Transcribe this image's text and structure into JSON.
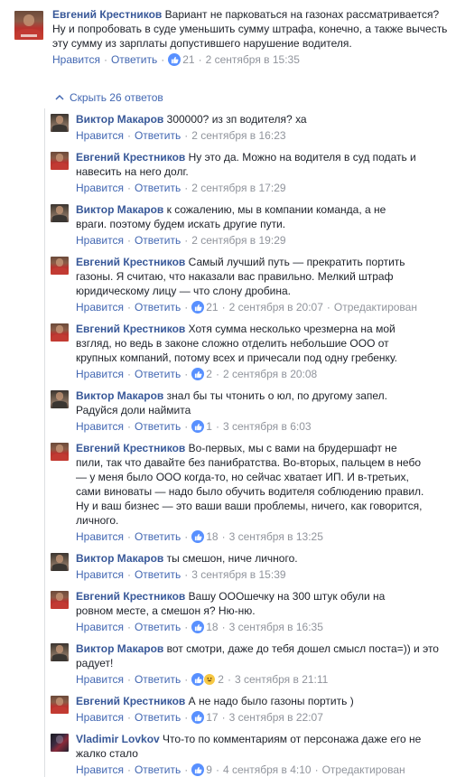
{
  "top_comment": {
    "author": "Евгений Крестников",
    "text": "Вариант не парковаться на газонах рассматривается? Ну и попробовать в суде уменьшить сумму штрафа, конечно, а также вычесть эту сумму из зарплаты допустившего нарушение водителя.",
    "like_label": "Нравится",
    "reply_label": "Ответить",
    "reactions": "21",
    "timestamp": "2 сентября в 15:35"
  },
  "hide_replies_label": "Скрыть 26 ответов",
  "replies": [
    {
      "author": "Виктор Макаров",
      "text": "300000? из зп водителя? ха",
      "like_label": "Нравится",
      "reply_label": "Ответить",
      "reactions": "",
      "timestamp": "2 сентября в 16:23",
      "edited": ""
    },
    {
      "author": "Евгений Крестников",
      "text": "Ну это да. Можно на водителя в суд подать и навесить на него долг.",
      "like_label": "Нравится",
      "reply_label": "Ответить",
      "reactions": "",
      "timestamp": "2 сентября в 17:29",
      "edited": ""
    },
    {
      "author": "Виктор Макаров",
      "text": "к сожалению, мы в компании команда, а не враги. поэтому будем искать другие пути.",
      "like_label": "Нравится",
      "reply_label": "Ответить",
      "reactions": "",
      "timestamp": "2 сентября в 19:29",
      "edited": ""
    },
    {
      "author": "Евгений Крестников",
      "text": "Самый лучший путь — прекратить портить газоны. Я считаю, что наказали вас правильно. Мелкий штраф юридическому лицу — что слону дробина.",
      "like_label": "Нравится",
      "reply_label": "Ответить",
      "reactions": "21",
      "timestamp": "2 сентября в 20:07",
      "edited": "Отредактирован"
    },
    {
      "author": "Евгений Крестников",
      "text": "Хотя сумма несколько чрезмерна на мой взгляд, но ведь в законе сложно отделить небольшие ООО от крупных компаний, потому всех и причесали под одну гребенку.",
      "like_label": "Нравится",
      "reply_label": "Ответить",
      "reactions": "2",
      "timestamp": "2 сентября в 20:08",
      "edited": ""
    },
    {
      "author": "Виктор Макаров",
      "text": "знал бы ты чтонить о юл, по другому запел. Радуйся доли наймита",
      "like_label": "Нравится",
      "reply_label": "Ответить",
      "reactions": "1",
      "timestamp": "3 сентября в 6:03",
      "edited": ""
    },
    {
      "author": "Евгений Крестников",
      "text": "Во-первых, мы с вами на брудершафт не пили, так что давайте без панибратства. Во-вторых, пальцем в небо — у меня было ООО когда-то, но сейчас хватает ИП. И в-третьих, сами виноваты — надо было обучить водителя соблюдению правил. Ну и ваш бизнес — это ваши ваши проблемы, ничего, как говорится, личного.",
      "like_label": "Нравится",
      "reply_label": "Ответить",
      "reactions": "18",
      "timestamp": "3 сентября в 13:25",
      "edited": ""
    },
    {
      "author": "Виктор Макаров",
      "text": "ты смешон, ниче личного.",
      "like_label": "Нравится",
      "reply_label": "Ответить",
      "reactions": "",
      "timestamp": "3 сентября в 15:39",
      "edited": ""
    },
    {
      "author": "Евгений Крестников",
      "text": "Вашу ОООшечку на 300 штук обули на ровном месте, а смешон я? Ню-ню.",
      "like_label": "Нравится",
      "reply_label": "Ответить",
      "reactions": "18",
      "timestamp": "3 сентября в 16:35",
      "edited": ""
    },
    {
      "author": "Виктор Макаров",
      "text": "вот смотри, даже до тебя дошел смысл поста=)) и это радует!",
      "like_label": "Нравится",
      "reply_label": "Ответить",
      "reactions": "2",
      "timestamp": "3 сентября в 21:11",
      "edited": ""
    },
    {
      "author": "Евгений Крестников",
      "text": "А не надо было газоны портить )",
      "like_label": "Нравится",
      "reply_label": "Ответить",
      "reactions": "17",
      "timestamp": "3 сентября в 22:07",
      "edited": ""
    },
    {
      "author": "Vladimir Lovkov",
      "text": "Что-то по комментариям от персонажа даже его не жалко стало",
      "like_label": "Нравится",
      "reply_label": "Ответить",
      "reactions": "9",
      "timestamp": "4 сентября в 4:10",
      "edited": "Отредактирован"
    }
  ]
}
